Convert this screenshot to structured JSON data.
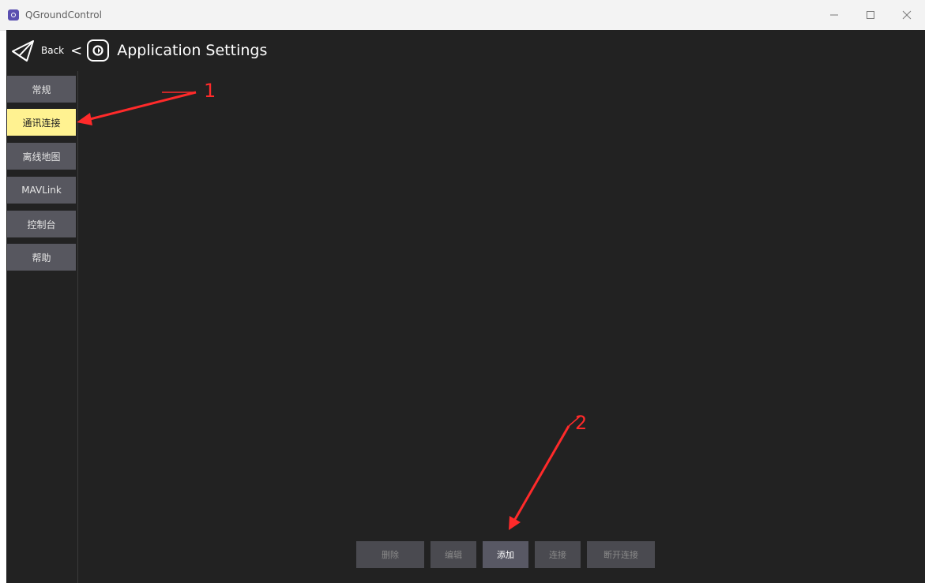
{
  "window": {
    "title": "QGroundControl",
    "controls": [
      "minimize-icon",
      "maximize-icon",
      "close-icon"
    ]
  },
  "toolbar": {
    "back_label": "Back",
    "separator": "<",
    "title": "Application Settings"
  },
  "sidebar": {
    "items": [
      {
        "label": "常规",
        "active": false
      },
      {
        "label": "通讯连接",
        "active": true
      },
      {
        "label": "离线地图",
        "active": false
      },
      {
        "label": "MAVLink",
        "active": false
      },
      {
        "label": "控制台",
        "active": false
      },
      {
        "label": "帮助",
        "active": false
      }
    ]
  },
  "actions": {
    "delete": "删除",
    "edit": "编辑",
    "add": "添加",
    "connect": "连接",
    "disconnect": "断开连接"
  },
  "annotations": {
    "one": "1",
    "two": "2",
    "color": "#ff2a2a"
  },
  "colors": {
    "active_item": "#fff291",
    "nav_item": "#57575f",
    "background": "#222222"
  }
}
